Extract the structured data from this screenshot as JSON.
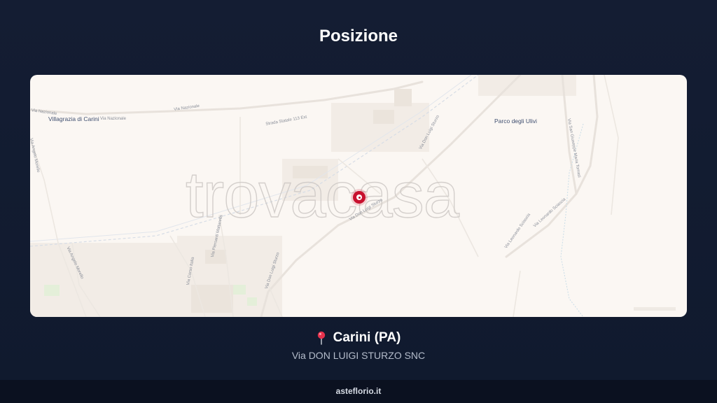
{
  "header": {
    "title": "Posizione"
  },
  "map": {
    "watermark": "trovacasa",
    "place_labels": [
      "Villagrazia di Carini",
      "Parco degli Ulivi"
    ],
    "road_labels": [
      "Via Nazionale",
      "Via Nazionale",
      "Via Nazionale",
      "Strada Statale 113 Est",
      "Via Don Luigi Sturzo",
      "Via Don Luigi Sturzo",
      "Via Don Luigi Sturzo",
      "Via Leonardo Sciascia",
      "Via Leonardo Sciascia",
      "Via Corso Italia",
      "Via Piersanti Mattarella",
      "Via Angelo Morello",
      "Via Angelo Morello",
      "Via San Giuseppe Maria Tomasi"
    ],
    "marker_color": "#c8102e"
  },
  "location": {
    "city": "Carini (PA)",
    "address": "Via DON LUIGI STURZO SNC",
    "icon": "round-pushpin-icon"
  },
  "footer": {
    "site": "asteflorio.it"
  }
}
